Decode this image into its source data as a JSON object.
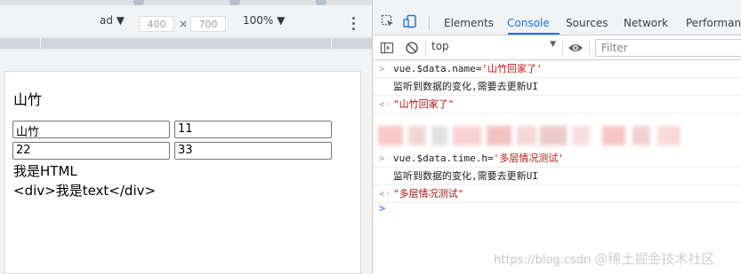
{
  "device_toolbar": {
    "device": "ad ▼",
    "width": "400",
    "separator": "×",
    "height": "700",
    "zoom": "100% ▼"
  },
  "page": {
    "heading": "山竹",
    "inputs": [
      "山竹",
      "11",
      "22",
      "33"
    ],
    "html_text": "我是HTML",
    "raw_text": "<div>我是text</div>"
  },
  "devtools": {
    "tabs": [
      "Elements",
      "Console",
      "Sources",
      "Network",
      "Performance"
    ],
    "active_tab": "Console",
    "accent": "#1a73e8"
  },
  "console_toolbar": {
    "context": "top",
    "filter_placeholder": "Filter"
  },
  "console": {
    "entries": [
      {
        "kind": "input",
        "gutter": ">",
        "code": "vue.$data.name=",
        "value": "'山竹回家了'"
      },
      {
        "kind": "log",
        "gutter": "",
        "text": "监听到数据的变化,需要去更新UI"
      },
      {
        "kind": "result",
        "gutter": "<·",
        "text": "\"山竹回家了\""
      },
      {
        "kind": "input",
        "gutter": ">",
        "code": "vue.$data.time.h=",
        "value": "'多层情况测试'"
      },
      {
        "kind": "log",
        "gutter": "",
        "text": "监听到数据的变化,需要去更新UI"
      },
      {
        "kind": "result",
        "gutter": "<·",
        "text": "\"多层情况测试\""
      }
    ],
    "prompt": ">"
  },
  "watermark": {
    "url": "https://blog.csdn",
    "brand": "@稀土掘金技术社区"
  }
}
